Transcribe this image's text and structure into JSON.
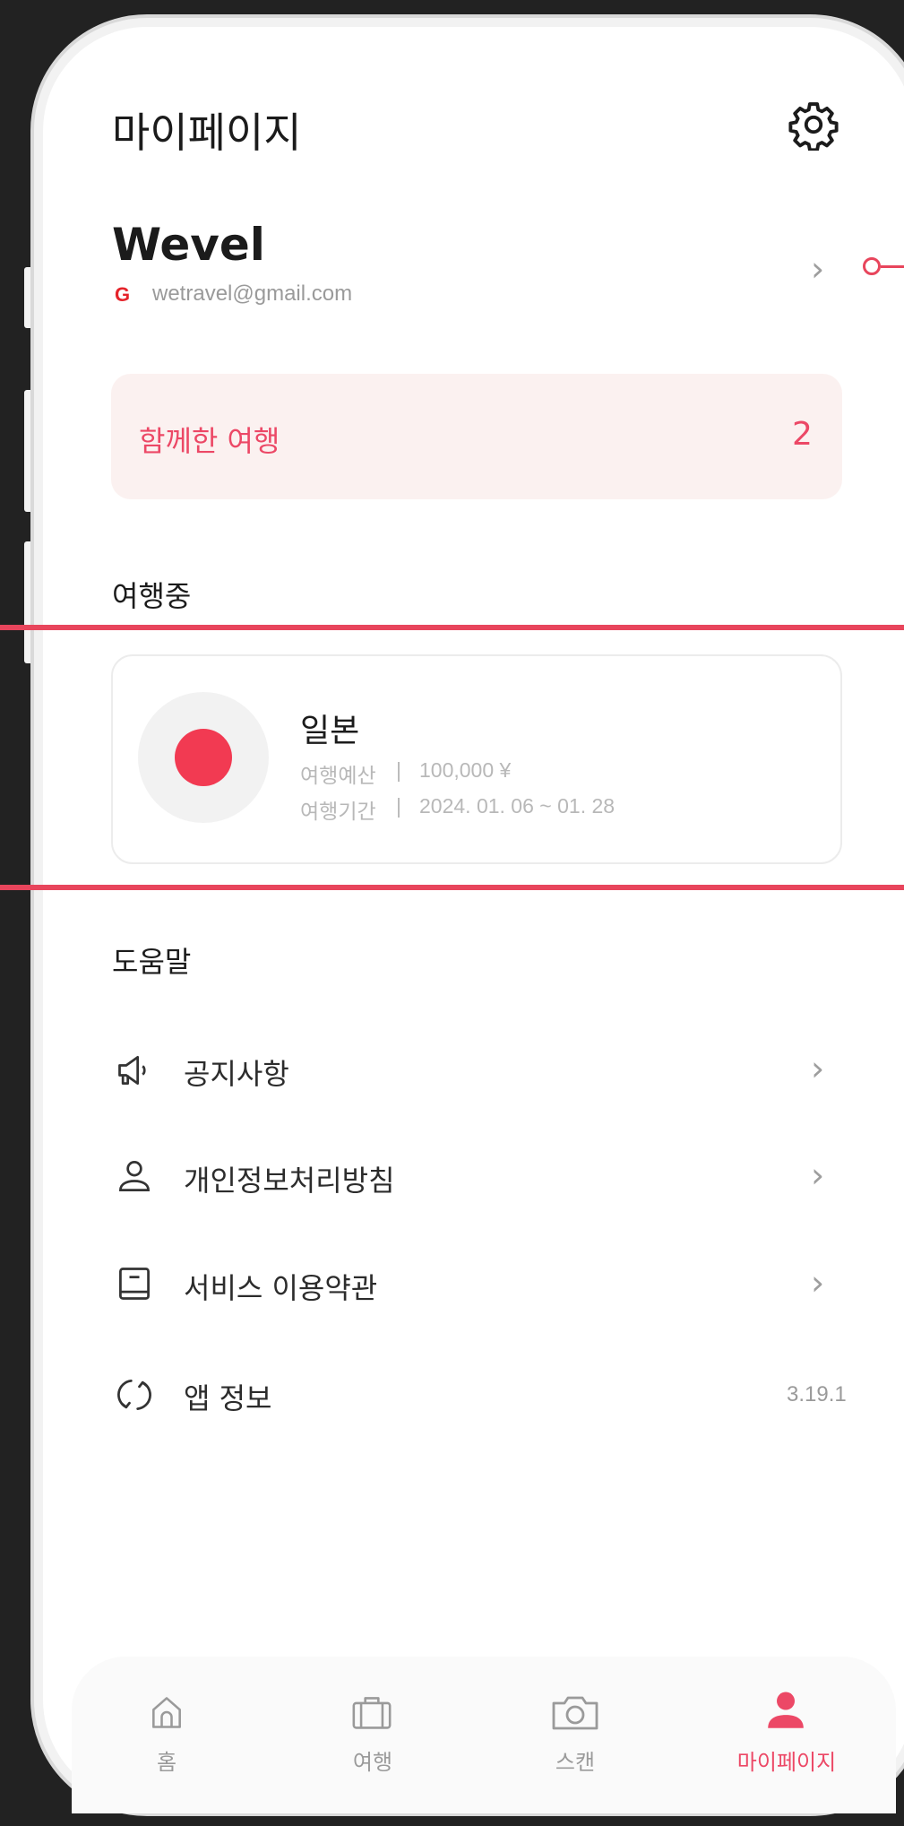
{
  "header": {
    "title": "마이페이지"
  },
  "profile": {
    "name": "Wevel",
    "provider_icon": "G",
    "email": "wetravel@gmail.com"
  },
  "together": {
    "label": "함께한 여행",
    "count": "2"
  },
  "traveling": {
    "heading": "여행중",
    "trip": {
      "name": "일본",
      "budget_label": "여행예산",
      "budget_value": "100,000 ¥",
      "period_label": "여행기간",
      "period_value": "2024. 01. 06 ~ 01. 28",
      "separator": "|"
    }
  },
  "help": {
    "heading": "도움말",
    "items": [
      {
        "label": "공지사항",
        "icon": "megaphone-icon"
      },
      {
        "label": "개인정보처리방침",
        "icon": "person-icon"
      },
      {
        "label": "서비스 이용약관",
        "icon": "book-icon"
      },
      {
        "label": "앱 정보",
        "icon": "refresh-icon",
        "value": "3.19.1"
      }
    ]
  },
  "tabbar": {
    "tabs": [
      {
        "label": "홈",
        "icon": "home-icon"
      },
      {
        "label": "여행",
        "icon": "suitcase-icon"
      },
      {
        "label": "스캔",
        "icon": "camera-icon"
      },
      {
        "label": "마이페이지",
        "icon": "user-icon",
        "active": true
      }
    ]
  },
  "colors": {
    "accent": "#ec4866",
    "callout": "#e8455c",
    "flag_red": "#f23a52",
    "card_tint": "#fbf1f0"
  }
}
